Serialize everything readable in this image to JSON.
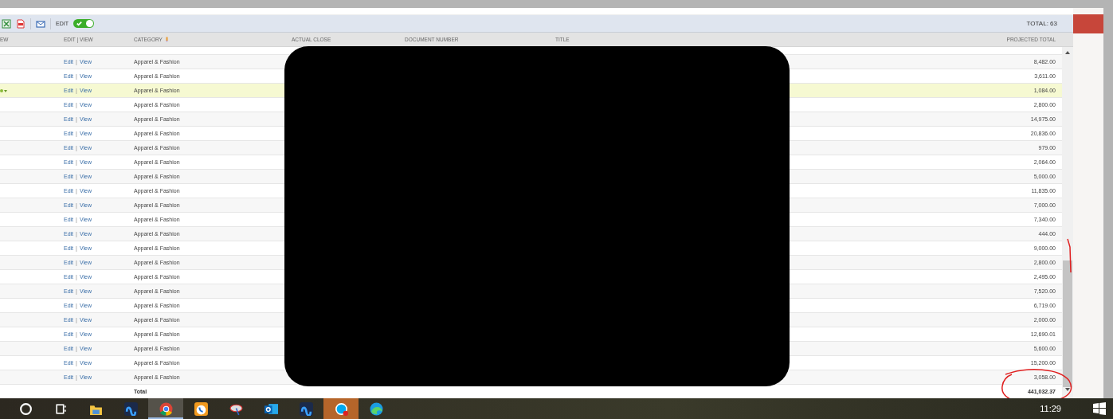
{
  "toolbar": {
    "edit_toggle": {
      "label": "EDIT",
      "on": true
    },
    "total": "TOTAL: 63"
  },
  "columns": [
    "EW",
    "EDIT | VIEW",
    "CATEGORY",
    "ACTUAL CLOSE",
    "DOCUMENT NUMBER",
    "TITLE",
    "PROJECTED TOTAL"
  ],
  "rows": [
    {
      "edit": "Edit",
      "view": "View",
      "category": "Apparel & Fashion",
      "projected_total": "8,482.00",
      "selected": false
    },
    {
      "edit": "Edit",
      "view": "View",
      "category": "Apparel & Fashion",
      "projected_total": "3,611.00",
      "selected": false
    },
    {
      "edit": "Edit",
      "view": "View",
      "category": "Apparel & Fashion",
      "projected_total": "1,084.00",
      "selected": true
    },
    {
      "edit": "Edit",
      "view": "View",
      "category": "Apparel & Fashion",
      "projected_total": "2,800.00",
      "selected": false
    },
    {
      "edit": "Edit",
      "view": "View",
      "category": "Apparel & Fashion",
      "projected_total": "14,975.00",
      "selected": false
    },
    {
      "edit": "Edit",
      "view": "View",
      "category": "Apparel & Fashion",
      "projected_total": "20,836.00",
      "selected": false
    },
    {
      "edit": "Edit",
      "view": "View",
      "category": "Apparel & Fashion",
      "projected_total": "979.00",
      "selected": false
    },
    {
      "edit": "Edit",
      "view": "View",
      "category": "Apparel & Fashion",
      "projected_total": "2,064.00",
      "selected": false
    },
    {
      "edit": "Edit",
      "view": "View",
      "category": "Apparel & Fashion",
      "projected_total": "5,000.00",
      "selected": false
    },
    {
      "edit": "Edit",
      "view": "View",
      "category": "Apparel & Fashion",
      "projected_total": "11,835.00",
      "selected": false
    },
    {
      "edit": "Edit",
      "view": "View",
      "category": "Apparel & Fashion",
      "projected_total": "7,000.00",
      "selected": false
    },
    {
      "edit": "Edit",
      "view": "View",
      "category": "Apparel & Fashion",
      "projected_total": "7,340.00",
      "selected": false
    },
    {
      "edit": "Edit",
      "view": "View",
      "category": "Apparel & Fashion",
      "projected_total": "444.00",
      "selected": false
    },
    {
      "edit": "Edit",
      "view": "View",
      "category": "Apparel & Fashion",
      "projected_total": "9,000.00",
      "selected": false
    },
    {
      "edit": "Edit",
      "view": "View",
      "category": "Apparel & Fashion",
      "projected_total": "2,800.00",
      "selected": false
    },
    {
      "edit": "Edit",
      "view": "View",
      "category": "Apparel & Fashion",
      "projected_total": "2,495.00",
      "selected": false
    },
    {
      "edit": "Edit",
      "view": "View",
      "category": "Apparel & Fashion",
      "projected_total": "7,520.00",
      "selected": false
    },
    {
      "edit": "Edit",
      "view": "View",
      "category": "Apparel & Fashion",
      "projected_total": "6,719.00",
      "selected": false
    },
    {
      "edit": "Edit",
      "view": "View",
      "category": "Apparel & Fashion",
      "projected_total": "2,000.00",
      "selected": false
    },
    {
      "edit": "Edit",
      "view": "View",
      "category": "Apparel & Fashion",
      "projected_total": "12,690.01",
      "selected": false
    },
    {
      "edit": "Edit",
      "view": "View",
      "category": "Apparel & Fashion",
      "projected_total": "5,600.00",
      "selected": false
    },
    {
      "edit": "Edit",
      "view": "View",
      "category": "Apparel & Fashion",
      "projected_total": "15,200.00",
      "selected": false
    },
    {
      "edit": "Edit",
      "view": "View",
      "category": "Apparel & Fashion",
      "projected_total": "3,058.00",
      "selected": false
    }
  ],
  "link_separator": "|",
  "total_row": {
    "label": "Total",
    "value": "441,032.37"
  },
  "taskbar": {
    "items": [
      {
        "kind": "search",
        "selected": false,
        "attention": false
      },
      {
        "kind": "taskview",
        "selected": false,
        "attention": false
      },
      {
        "kind": "folder",
        "selected": false,
        "attention": false
      },
      {
        "kind": "loop",
        "selected": false,
        "attention": false
      },
      {
        "kind": "browser",
        "selected": true,
        "attention": false
      },
      {
        "kind": "phone",
        "selected": false,
        "attention": false
      },
      {
        "kind": "dish",
        "selected": false,
        "attention": false
      },
      {
        "kind": "mail",
        "selected": false,
        "attention": false
      },
      {
        "kind": "loop",
        "selected": false,
        "attention": false
      },
      {
        "kind": "chat",
        "selected": false,
        "attention": true
      },
      {
        "kind": "wave",
        "selected": false,
        "attention": false
      }
    ],
    "time": "11:29"
  }
}
